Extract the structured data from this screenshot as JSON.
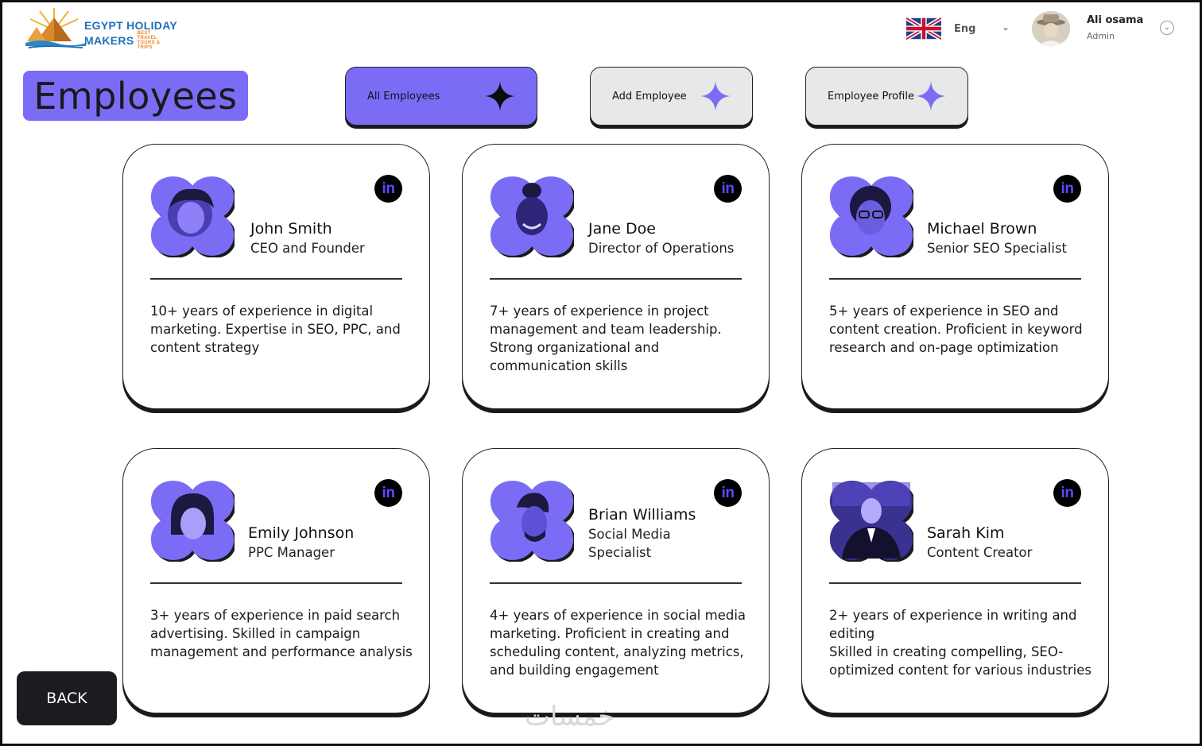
{
  "header": {
    "logo_line1": "EGYPT HOLIDAY",
    "logo_line2": "MAKERS",
    "logo_tagline": "BEST TRAVEL TOURS & TRIPS",
    "language": "Eng",
    "user_name": "Ali osama",
    "user_role": "Admin"
  },
  "page_title": "Employees",
  "tabs": [
    {
      "label": "All Employees"
    },
    {
      "label": "Add Employee"
    },
    {
      "label": "Employee Profile"
    }
  ],
  "employees": [
    {
      "name": "John Smith",
      "role": "CEO and Founder",
      "description": "10+ years of experience in digital marketing. Expertise in SEO, PPC, and content strategy"
    },
    {
      "name": "Jane Doe",
      "role": "Director of Operations",
      "description": "7+ years of experience in project management and team leadership. Strong organizational and communication skills"
    },
    {
      "name": "Michael Brown",
      "role": "Senior SEO Specialist",
      "description": "5+ years of experience in SEO and content creation. Proficient in keyword research and on-page optimization"
    },
    {
      "name": "Emily Johnson",
      "role": "PPC Manager",
      "description": "3+ years of experience in paid search advertising. Skilled in campaign management and performance analysis"
    },
    {
      "name": "Brian Williams",
      "role": "Social Media Specialist",
      "description": "4+ years of experience in social media marketing. Proficient in creating and scheduling content, analyzing metrics, and building engagement"
    },
    {
      "name": "Sarah Kim",
      "role": "Content Creator",
      "description": "2+ years of experience in writing and editing\nSkilled in creating compelling, SEO-optimized content for various industries"
    }
  ],
  "linkedin_label": "in",
  "back_label": "BACK",
  "watermark": "خمسات",
  "colors": {
    "accent": "#7b6cf6",
    "dark": "#1b1b22",
    "tab_inactive": "#e8e8e8"
  }
}
